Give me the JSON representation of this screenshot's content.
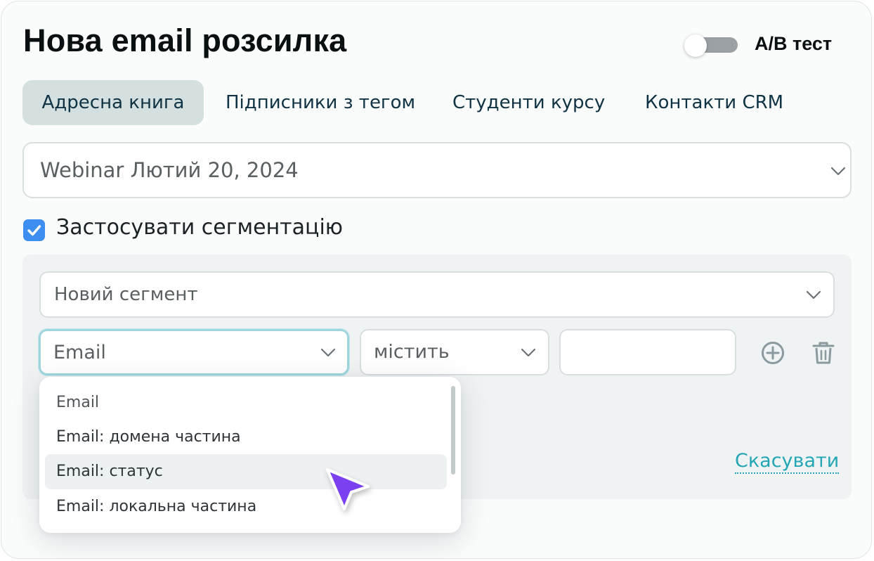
{
  "header": {
    "title": "Нова email розсилка",
    "ab_toggle": {
      "label": "A/B тест",
      "on": false
    }
  },
  "tabs": [
    {
      "label": "Адресна книга",
      "active": true
    },
    {
      "label": "Підписники з тегом",
      "active": false
    },
    {
      "label": "Студенти курсу",
      "active": false
    },
    {
      "label": "Контакти CRM",
      "active": false
    }
  ],
  "address_book_select": {
    "value": "Webinar Лютий 20, 2024"
  },
  "segmentation": {
    "checkbox_label": "Застосувати сегментацію",
    "checked": true,
    "segment_select": {
      "value": "Новий сегмент"
    },
    "condition": {
      "field": "Email",
      "operator": "містить",
      "value": ""
    },
    "cancel_label": "Скасувати",
    "field_dropdown": {
      "options": [
        "Email",
        "Email: домена частина",
        "Email: статус",
        "Email: локальна частина"
      ],
      "hovered": "Email: статус"
    }
  },
  "icons": {
    "add": "plus-circle-icon",
    "delete": "trash-icon",
    "chevron": "chevron-down-icon",
    "check": "checkmark-icon",
    "cursor": "pointer-cursor-icon"
  },
  "colors": {
    "accent_blue": "#3d8ef0",
    "active_tab_bg": "#d3e0df",
    "link_teal": "#24a6b4",
    "cursor_purple": "#7a3ff2",
    "focus_border": "#9fd6de"
  }
}
